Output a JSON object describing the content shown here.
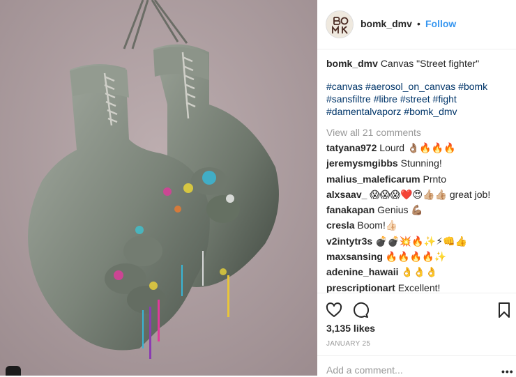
{
  "post": {
    "username": "bomk_dmv",
    "separator": "•",
    "follow_label": "Follow",
    "avatar_text": "BOMK"
  },
  "caption": {
    "username": "bomk_dmv",
    "text": "Canvas \"Street fighter\"",
    "hashtags": [
      "#canvas",
      "#aerosol_on_canvas",
      "#bomk",
      "#sansfiltre",
      "#libre",
      "#street",
      "#fight",
      "#damentalvaporz",
      "#bomk_dmv"
    ]
  },
  "view_all_comments": "View all 21 comments",
  "comments": [
    {
      "user": "tatyana972",
      "text": "Lourd 👌🏽🔥🔥🔥"
    },
    {
      "user": "jeremysmgibbs",
      "text": "Stunning!"
    },
    {
      "user": "malius_maleficarum",
      "text": "Prnto"
    },
    {
      "user": "alxsaav_",
      "text": "😱😱😱❤️😍👍🏼👍🏼 great job!"
    },
    {
      "user": "fanakapan",
      "text": "Genius 💪🏽"
    },
    {
      "user": "cresla",
      "text": "Boom!👍🏻"
    },
    {
      "user": "v2intytr3s",
      "text": "💣💣💥🔥✨⚡👊👍"
    },
    {
      "user": "maxsansing",
      "text": "🔥🔥🔥🔥✨"
    },
    {
      "user": "adenine_hawaii",
      "text": "👌👌👌"
    },
    {
      "user": "prescriptionart",
      "text": "Excellent!"
    }
  ],
  "actions": {
    "like_icon": "heart-icon",
    "comment_icon": "comment-bubble-icon",
    "save_icon": "bookmark-icon"
  },
  "likes": "3,135 likes",
  "date": "JANUARY 25",
  "add_comment": {
    "placeholder": "Add a comment..."
  },
  "more_label": "•••",
  "colors": {
    "follow": "#3897f0",
    "hashtag": "#003569",
    "muted": "#999999",
    "background_wall": "#b3a3a6"
  }
}
